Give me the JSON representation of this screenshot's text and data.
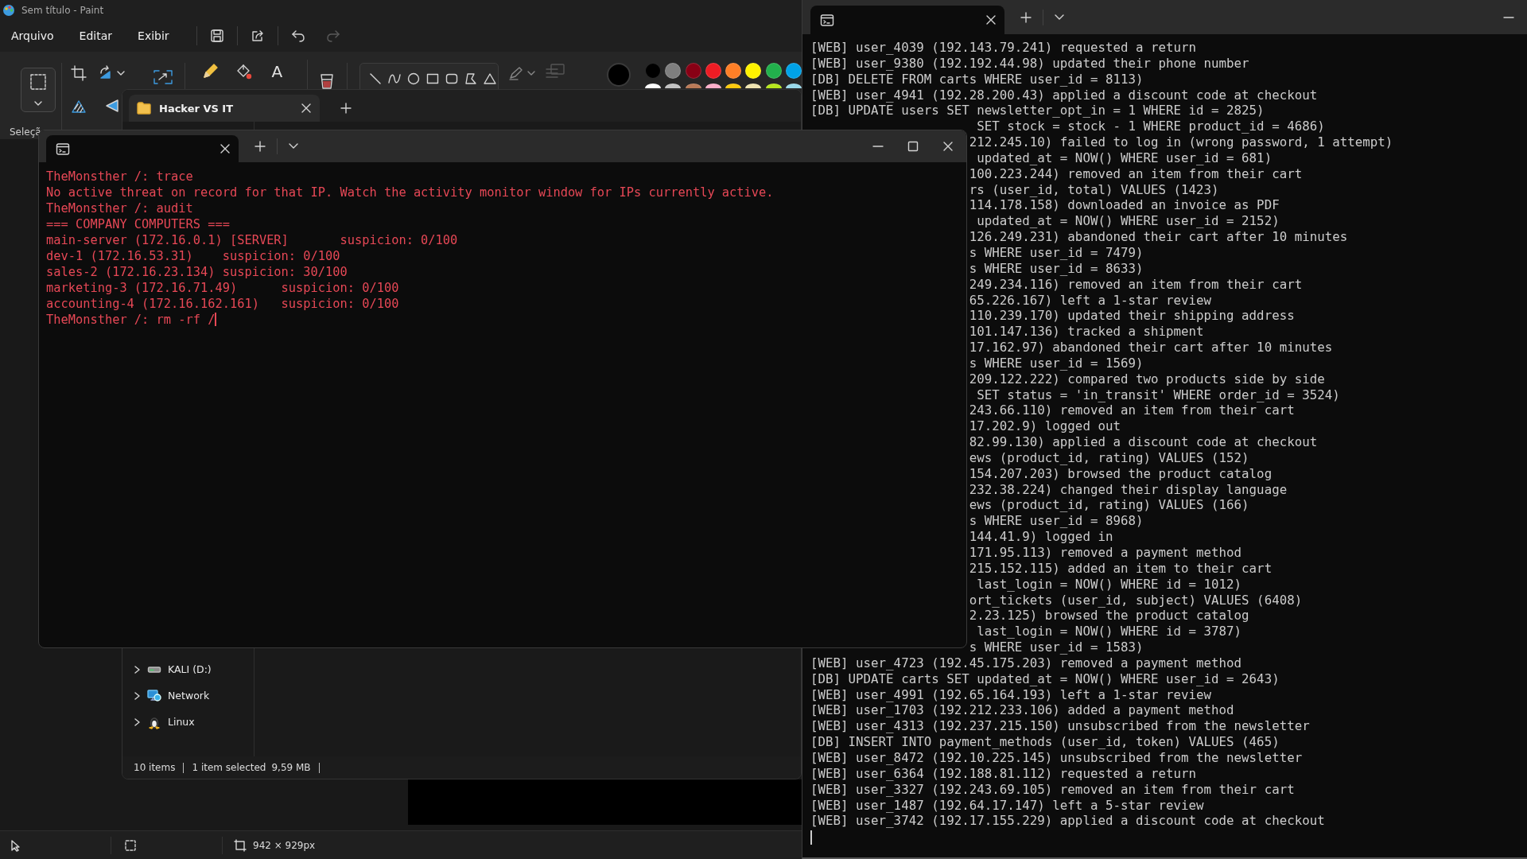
{
  "paint": {
    "title": "Sem título - Paint",
    "menu": [
      "Arquivo",
      "Editar",
      "Exibir"
    ],
    "history": {
      "undo_disabled": false,
      "redo_disabled": true
    },
    "selection_label": "Seleçã",
    "text_tool": "A",
    "current_color": {
      "color": "#000000"
    },
    "palette": [
      {
        "color": "#000000"
      },
      {
        "color": "#7f7f7f"
      },
      {
        "color": "#880015"
      },
      {
        "color": "#ed1c24"
      },
      {
        "color": "#ff7f27"
      },
      {
        "color": "#fff200"
      },
      {
        "color": "#22b14c"
      },
      {
        "color": "#00a2e8"
      },
      {
        "color": "#ffffff"
      },
      {
        "color": "#c3c3c3"
      },
      {
        "color": "#b97a57"
      },
      {
        "color": "#ffaec9"
      },
      {
        "color": "#ffc90e"
      },
      {
        "color": "#efe4b0"
      },
      {
        "color": "#b5e61d"
      },
      {
        "color": "#99d9ea"
      }
    ],
    "status_bar": {
      "canvas_size": "942 × 929px"
    }
  },
  "explorer": {
    "tab": {
      "title": "Hacker VS IT"
    },
    "nav_items": [
      {
        "label": "KALI (D:)",
        "kind": "drive",
        "expanded": false
      },
      {
        "label": "Network",
        "kind": "network",
        "expanded": false
      },
      {
        "label": "Linux",
        "kind": "linux",
        "expanded": false
      }
    ],
    "status_bar": {
      "item_count": "10 items",
      "selection": "1 item selected",
      "size": "9,59 MB"
    }
  },
  "command_terminal": {
    "cursor": true,
    "lines": [
      "TheMonsther /: trace",
      "No active threat on record for that IP. Watch the activity monitor window for IPs currently active.",
      "TheMonsther /: audit",
      "=== COMPANY COMPUTERS ===",
      "main-server (172.16.0.1) [SERVER]       suspicion: 0/100",
      "dev-1 (172.16.53.31)    suspicion: 0/100",
      "sales-2 (172.16.23.134) suspicion: 30/100",
      "marketing-3 (172.16.71.49)      suspicion: 0/100",
      "accounting-4 (172.16.162.161)   suspicion: 0/100",
      "TheMonsther /: rm -rf /"
    ]
  },
  "monitor_terminal": {
    "cursor": true,
    "lines": [
      {
        "kind": "full",
        "text": "[WEB] user_4039 (192.143.79.241) requested a return"
      },
      {
        "kind": "full",
        "text": "[WEB] user_9380 (192.192.44.98) updated their phone number"
      },
      {
        "kind": "full",
        "text": "[DB] DELETE FROM carts WHERE user_id = 8113)"
      },
      {
        "kind": "full",
        "text": "[WEB] user_4941 (192.28.200.43) applied a discount code at checkout"
      },
      {
        "kind": "full",
        "text": "[DB] UPDATE users SET newsletter_opt_in = 1 WHERE id = 2825)"
      },
      {
        "kind": "partial",
        "text": " SET stock = stock - 1 WHERE product_id = 4686)"
      },
      {
        "kind": "partial",
        "text": "212.245.10) failed to log in (wrong password, 1 attempt)"
      },
      {
        "kind": "partial",
        "text": " updated_at = NOW() WHERE user_id = 681)"
      },
      {
        "kind": "partial",
        "text": "100.223.244) removed an item from their cart"
      },
      {
        "kind": "partial",
        "text": "rs (user_id, total) VALUES (1423)"
      },
      {
        "kind": "partial",
        "text": "114.178.158) downloaded an invoice as PDF"
      },
      {
        "kind": "partial",
        "text": " updated_at = NOW() WHERE user_id = 2152)"
      },
      {
        "kind": "partial",
        "text": "126.249.231) abandoned their cart after 10 minutes"
      },
      {
        "kind": "partial",
        "text": "s WHERE user_id = 7479)"
      },
      {
        "kind": "partial",
        "text": "s WHERE user_id = 8633)"
      },
      {
        "kind": "partial",
        "text": "249.234.116) removed an item from their cart"
      },
      {
        "kind": "partial",
        "text": "65.226.167) left a 1-star review"
      },
      {
        "kind": "partial",
        "text": "110.239.170) updated their shipping address"
      },
      {
        "kind": "partial",
        "text": "101.147.136) tracked a shipment"
      },
      {
        "kind": "partial",
        "text": "17.162.97) abandoned their cart after 10 minutes"
      },
      {
        "kind": "partial",
        "text": "s WHERE user_id = 1569)"
      },
      {
        "kind": "partial",
        "text": "209.122.222) compared two products side by side"
      },
      {
        "kind": "partial",
        "text": " SET status = 'in_transit' WHERE order_id = 3524)"
      },
      {
        "kind": "partial",
        "text": "243.66.110) removed an item from their cart"
      },
      {
        "kind": "partial",
        "text": "17.202.9) logged out"
      },
      {
        "kind": "partial",
        "text": "82.99.130) applied a discount code at checkout"
      },
      {
        "kind": "partial",
        "text": "ews (product_id, rating) VALUES (152)"
      },
      {
        "kind": "partial",
        "text": "154.207.203) browsed the product catalog"
      },
      {
        "kind": "partial",
        "text": "232.38.224) changed their display language"
      },
      {
        "kind": "partial",
        "text": "ews (product_id, rating) VALUES (166)"
      },
      {
        "kind": "partial",
        "text": "s WHERE user_id = 8968)"
      },
      {
        "kind": "partial",
        "text": "144.41.9) logged in"
      },
      {
        "kind": "partial",
        "text": "171.95.113) removed a payment method"
      },
      {
        "kind": "partial",
        "text": "215.152.115) added an item to their cart"
      },
      {
        "kind": "partial",
        "text": " last_login = NOW() WHERE id = 1012)"
      },
      {
        "kind": "partial",
        "text": "ort_tickets (user_id, subject) VALUES (6408)"
      },
      {
        "kind": "partial",
        "text": "2.23.125) browsed the product catalog"
      },
      {
        "kind": "partial",
        "text": " last_login = NOW() WHERE id = 3787)"
      },
      {
        "kind": "partial",
        "text": "s WHERE user_id = 1583)"
      },
      {
        "kind": "full",
        "text": "[WEB] user_4723 (192.45.175.203) removed a payment method"
      },
      {
        "kind": "full",
        "text": "[DB] UPDATE carts SET updated_at = NOW() WHERE user_id = 2643)"
      },
      {
        "kind": "full",
        "text": "[WEB] user_4991 (192.65.164.193) left a 1-star review"
      },
      {
        "kind": "full",
        "text": "[WEB] user_1703 (192.212.233.106) added a payment method"
      },
      {
        "kind": "full",
        "text": "[WEB] user_4313 (192.237.215.150) unsubscribed from the newsletter"
      },
      {
        "kind": "full",
        "text": "[DB] INSERT INTO payment_methods (user_id, token) VALUES (465)"
      },
      {
        "kind": "full",
        "text": "[WEB] user_8472 (192.10.225.145) unsubscribed from the newsletter"
      },
      {
        "kind": "full",
        "text": "[WEB] user_6364 (192.188.81.112) requested a return"
      },
      {
        "kind": "full",
        "text": "[WEB] user_3327 (192.243.69.105) removed an item from their cart"
      },
      {
        "kind": "full",
        "text": "[WEB] user_1487 (192.64.17.147) left a 5-star review"
      },
      {
        "kind": "full",
        "text": "[WEB] user_3742 (192.17.155.229) applied a discount code at checkout"
      }
    ]
  }
}
